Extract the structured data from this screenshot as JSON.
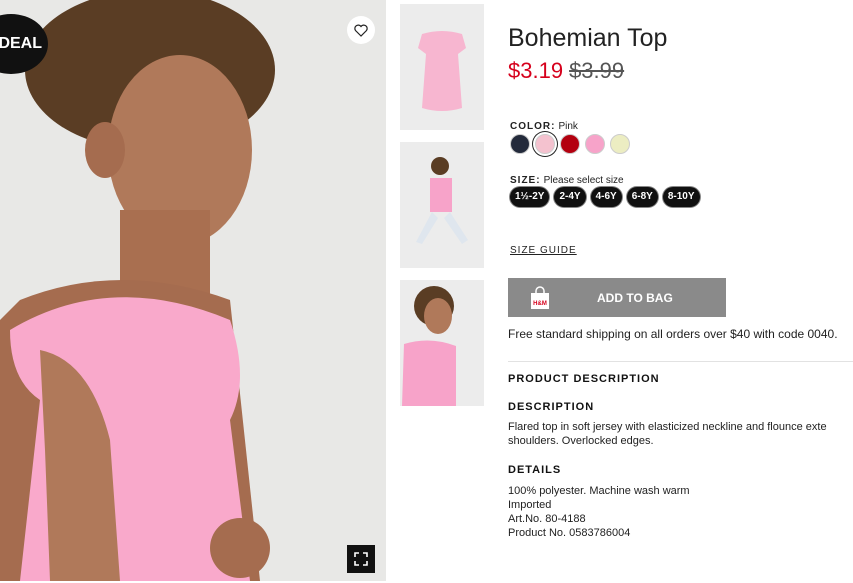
{
  "badge": {
    "label": "DEAL"
  },
  "icons": {
    "favorite": "heart-outline-icon",
    "zoom": "fullscreen-icon",
    "bag": "shopping-bag-icon"
  },
  "product": {
    "title": "Bohemian Top",
    "price_current": "$3.19",
    "price_original": "$3.99"
  },
  "color": {
    "label": "COLOR:",
    "selected": "Pink",
    "swatches": [
      {
        "name": "navy",
        "hex": "#232a3b"
      },
      {
        "name": "light-pink",
        "hex": "#f4c2cf"
      },
      {
        "name": "red",
        "hex": "#b3000f"
      },
      {
        "name": "pink",
        "hex": "#f7a3c9"
      },
      {
        "name": "light-yellow",
        "hex": "#ecedc2"
      }
    ]
  },
  "size": {
    "label": "SIZE:",
    "prompt": "Please select size",
    "options": [
      "1½-2Y",
      "2-4Y",
      "4-6Y",
      "6-8Y",
      "8-10Y"
    ]
  },
  "size_guide": "SIZE GUIDE",
  "add_to_bag": {
    "label": "ADD TO BAG",
    "icon_text": "H&M"
  },
  "shipping": "Free standard shipping on all orders over $40 with code 0040.",
  "product_description": {
    "heading": "PRODUCT DESCRIPTION",
    "description_heading": "DESCRIPTION",
    "description_lines": [
      "Flared top in soft jersey with elasticized neckline and flounce exte",
      "shoulders. Overlocked edges."
    ],
    "details_heading": "DETAILS",
    "details": [
      "100% polyester. Machine wash warm",
      "Imported",
      "Art.No. 80-4188",
      "Product No. 0583786004"
    ]
  },
  "colors": {
    "sale_red": "#d6001c",
    "button_gray": "#8a8a8a",
    "top_pink": "#f9a9cb"
  }
}
